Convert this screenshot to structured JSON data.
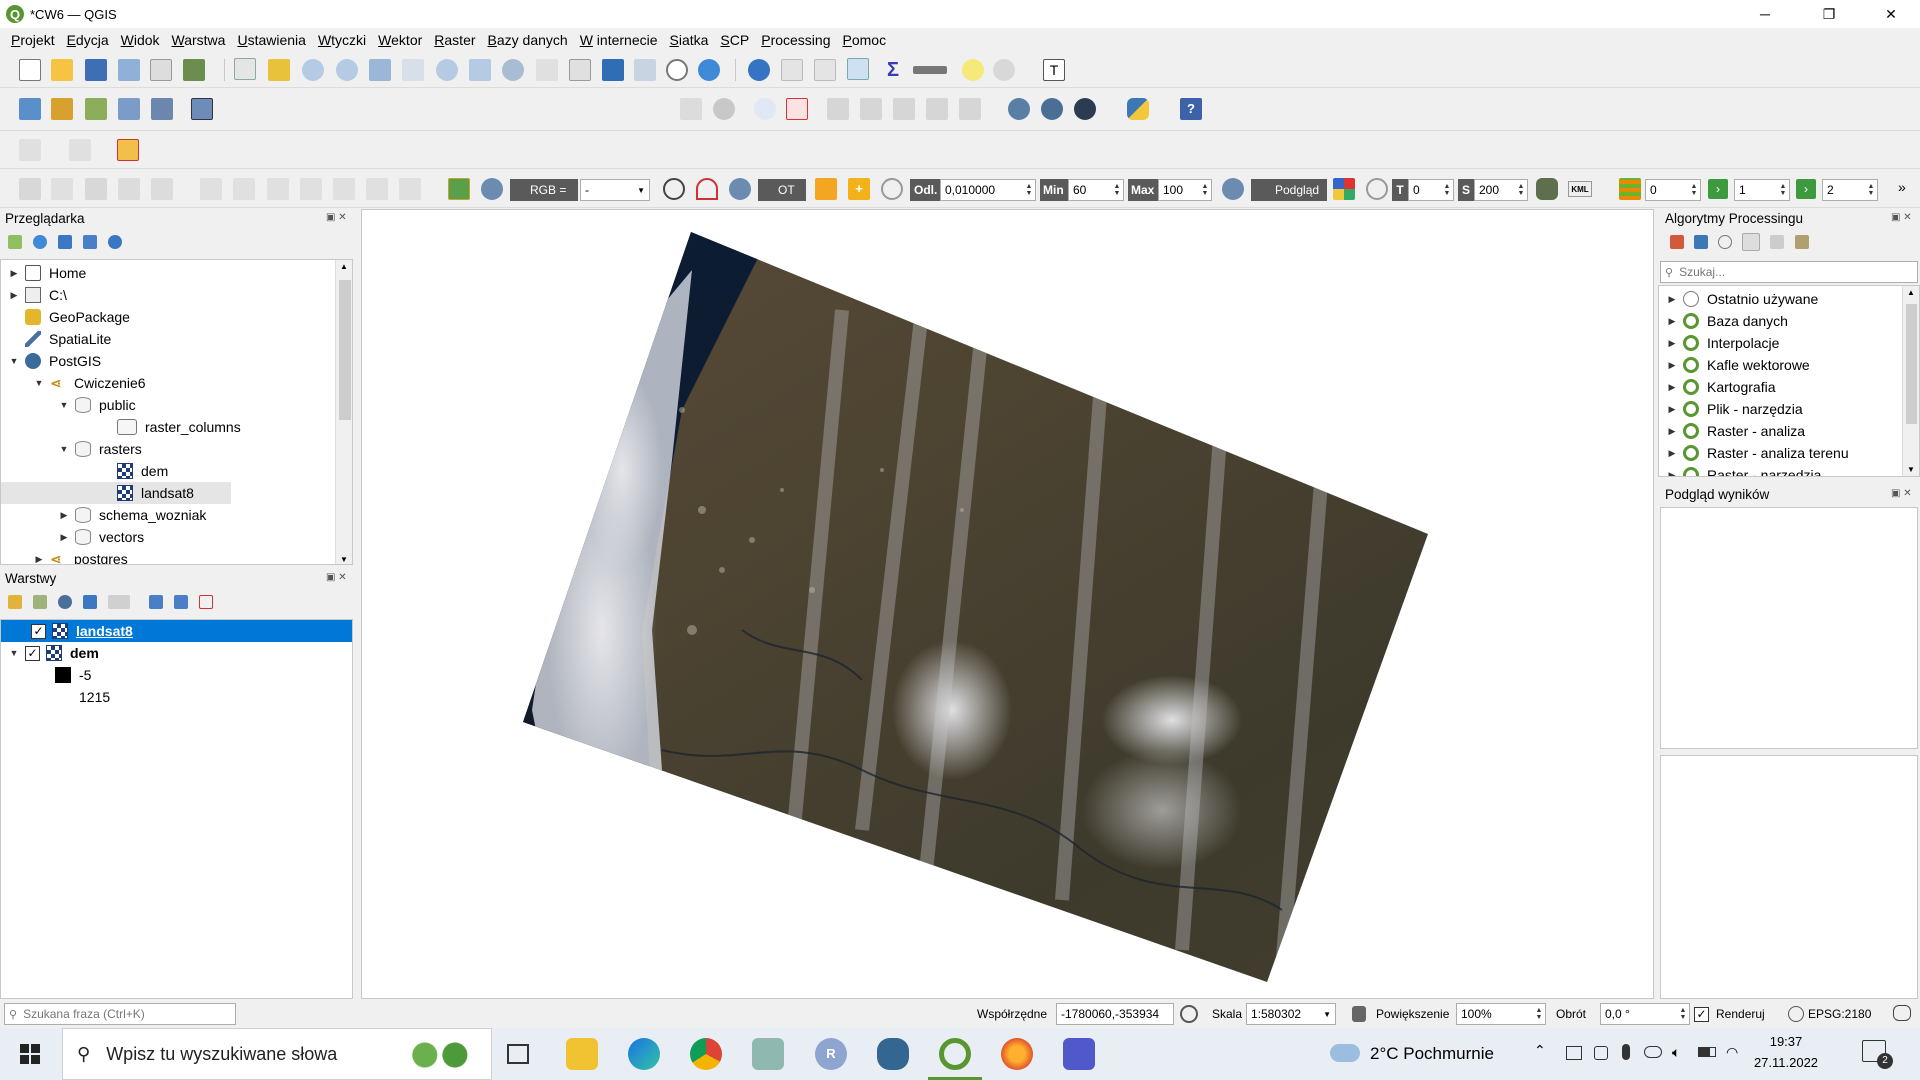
{
  "window": {
    "title": "*CW6 — QGIS",
    "minimize": "─",
    "maximize": "❐",
    "close": "✕"
  },
  "menu": [
    "Projekt",
    "Edycja",
    "Widok",
    "Warstwa",
    "Ustawienia",
    "Wtyczki",
    "Wektor",
    "Raster",
    "Bazy danych",
    "W internecie",
    "Siatka",
    "SCP",
    "Processing",
    "Pomoc"
  ],
  "scp_toolbar": {
    "rgb_label": "RGB =",
    "rgb_value": "-",
    "ot_label": "OT",
    "odl_label": "Odl.",
    "odl_value": "0,010000",
    "min_label": "Min",
    "min_value": "60",
    "max_label": "Max",
    "max_value": "100",
    "preview_label": "Podgląd",
    "t_label": "T",
    "t_value": "0",
    "s_label": "S",
    "s_value": "200",
    "kml_label": "KML",
    "band1_value": "0",
    "band2_value": "1",
    "band3_value": "2"
  },
  "browser": {
    "title": "Przeglądarka",
    "items": [
      {
        "label": "Home",
        "arrow": "▶"
      },
      {
        "label": "C:\\",
        "arrow": "▶"
      },
      {
        "label": "GeoPackage",
        "arrow": ""
      },
      {
        "label": "SpatiaLite",
        "arrow": ""
      },
      {
        "label": "PostGIS",
        "arrow": "▼"
      },
      {
        "label": "Cwiczenie6",
        "arrow": "▼"
      },
      {
        "label": "public",
        "arrow": "▼"
      },
      {
        "label": "raster_columns",
        "arrow": ""
      },
      {
        "label": "rasters",
        "arrow": "▼"
      },
      {
        "label": "dem",
        "arrow": ""
      },
      {
        "label": "landsat8",
        "arrow": ""
      },
      {
        "label": "schema_wozniak",
        "arrow": "▶"
      },
      {
        "label": "vectors",
        "arrow": "▶"
      },
      {
        "label": "postgres",
        "arrow": "▶"
      }
    ]
  },
  "layers": {
    "title": "Warstwy",
    "items": [
      {
        "label": "landsat8",
        "checked": "✓"
      },
      {
        "label": "dem",
        "checked": "✓",
        "arrow": "▼"
      }
    ],
    "legend_min": "-5",
    "legend_max": "1215"
  },
  "processing": {
    "title": "Algorytmy Processingu",
    "search_placeholder": "Szukaj...",
    "items": [
      "Ostatnio używane",
      "Baza danych",
      "Interpolacje",
      "Kafle wektorowe",
      "Kartografia",
      "Plik - narzędzia",
      "Raster - analiza",
      "Raster - analiza terenu",
      "Raster - narzędzia"
    ]
  },
  "results_preview": {
    "title": "Podgląd wyników"
  },
  "statusbar": {
    "search_placeholder": "Szukana fraza (Ctrl+K)",
    "coord_label": "Współrzędne",
    "coord_value": "-1780060,-353934",
    "scale_label": "Skala",
    "scale_value": "1:580302",
    "zoom_label": "Powiększenie",
    "zoom_value": "100%",
    "rotation_label": "Obrót",
    "rotation_value": "0,0 °",
    "render_label": "Renderuj",
    "render_checked": "✓",
    "crs": "EPSG:2180"
  },
  "taskbar": {
    "search_placeholder": "Wpisz tu wyszukiwane słowa",
    "weather": "2°C  Pochmurnie",
    "time": "19:37",
    "date": "27.11.2022",
    "notifications": "2"
  },
  "colors": {
    "qgis_green": "#589632",
    "selection_blue": "#0078d7",
    "taskbar_bg": "#e9eef4"
  }
}
